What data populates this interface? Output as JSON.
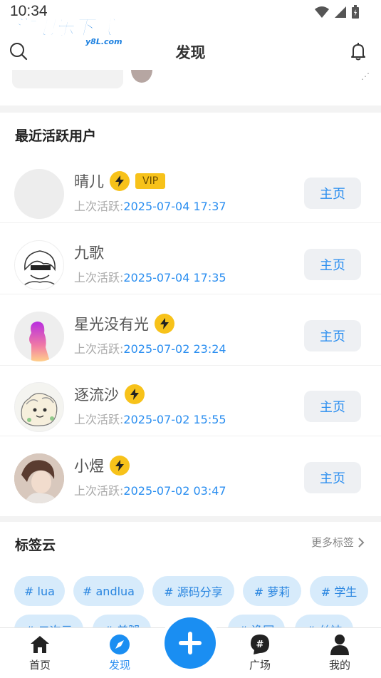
{
  "status_bar": {
    "time": "10:34"
  },
  "watermark": {
    "text": "游吧乐下载",
    "domain": "y8L.com"
  },
  "header": {
    "title": "发现"
  },
  "active_section": {
    "title": "最近活跃用户"
  },
  "users": [
    {
      "name": "晴儿",
      "badges": [
        "bolt",
        "vip"
      ],
      "vip_label": "VIP",
      "last_active_label": "上次活跃:",
      "last_active": "2025-07-04 17:37",
      "button": "主页"
    },
    {
      "name": "九歌",
      "badges": [],
      "last_active_label": "上次活跃:",
      "last_active": "2025-07-04 17:35",
      "button": "主页"
    },
    {
      "name": "星光没有光",
      "badges": [
        "bolt"
      ],
      "last_active_label": "上次活跃:",
      "last_active": "2025-07-02 23:24",
      "button": "主页"
    },
    {
      "name": "逐流沙",
      "badges": [
        "bolt"
      ],
      "last_active_label": "上次活跃:",
      "last_active": "2025-07-02 15:55",
      "button": "主页"
    },
    {
      "name": "小煜",
      "badges": [
        "bolt"
      ],
      "last_active_label": "上次活跃:",
      "last_active": "2025-07-02 03:47",
      "button": "主页"
    }
  ],
  "tags_section": {
    "title": "标签云",
    "more": "更多标签",
    "tags": [
      "# lua",
      "# andlua",
      "# 源码分享",
      "# 萝莉",
      "# 学生",
      "# 二次元",
      "# 美腿",
      "# 逸园",
      "# 丝袜"
    ]
  },
  "bottom_nav": {
    "items": [
      {
        "label": "首页",
        "icon": "home-icon",
        "active": false
      },
      {
        "label": "发现",
        "icon": "compass-icon",
        "active": true
      },
      {
        "label": "广场",
        "icon": "hashtag-icon",
        "active": false
      },
      {
        "label": "我的",
        "icon": "person-icon",
        "active": false
      }
    ],
    "fab_icon": "plus-icon"
  },
  "colors": {
    "accent": "#2a8ef0",
    "badge": "#f7c21a",
    "tag_bg": "#d7ebfb"
  }
}
